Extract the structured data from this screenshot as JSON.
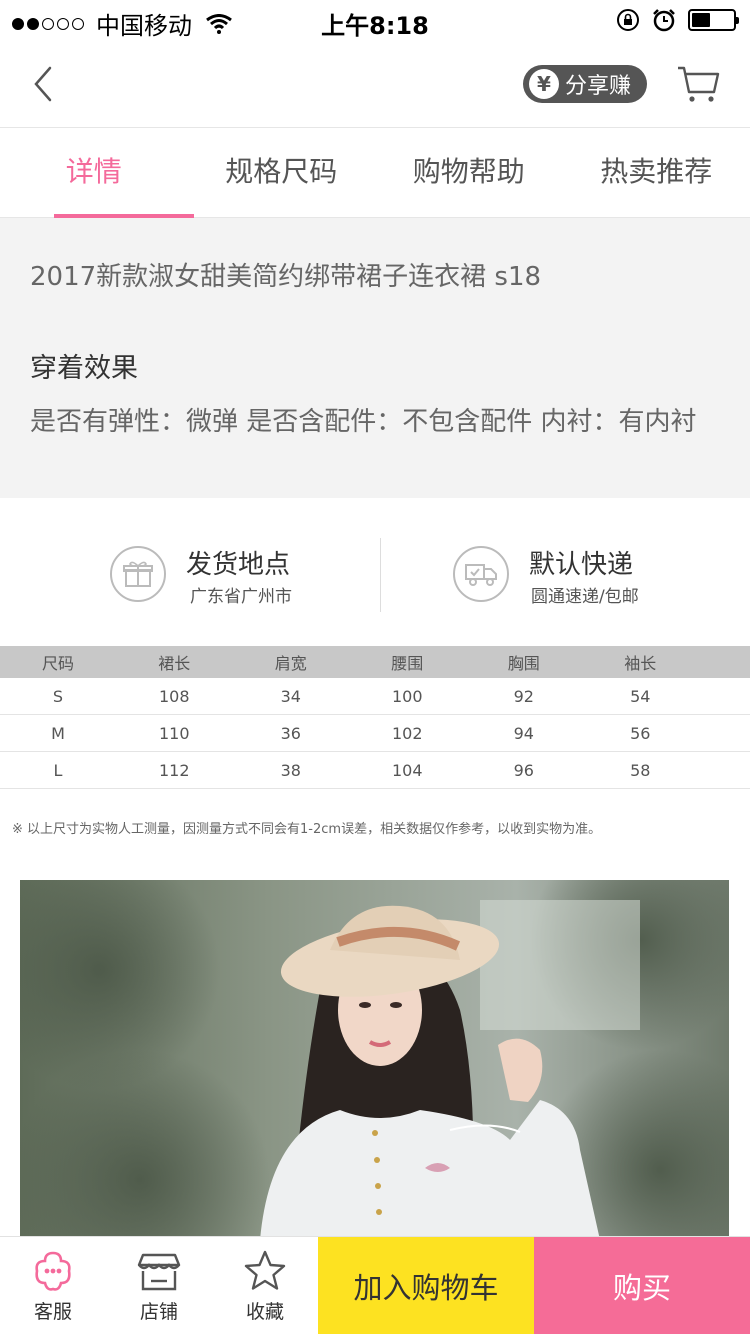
{
  "status_bar": {
    "carrier": "中国移动",
    "time": "上午8:18",
    "battery_level": 0.45
  },
  "nav": {
    "share_symbol": "¥",
    "share_label": "分享赚",
    "icons": [
      "back-arrow-icon",
      "cart-icon"
    ]
  },
  "tabs": [
    {
      "label": "详情",
      "active": true
    },
    {
      "label": "规格尺码",
      "active": false
    },
    {
      "label": "购物帮助",
      "active": false
    },
    {
      "label": "热卖推荐",
      "active": false
    }
  ],
  "detail": {
    "product_title": "2017新款淑女甜美简约绑带裙子连衣裙 s18",
    "section_title": "穿着效果",
    "attributes": "是否有弹性：微弹 是否含配件：不包含配件 内衬：有内衬"
  },
  "shipping": {
    "origin_label": "发货地点",
    "origin_value": "广东省广州市",
    "courier_label": "默认快递",
    "courier_value": "圆通速递/包邮"
  },
  "size_table": {
    "headers": [
      "尺码",
      "裙长",
      "肩宽",
      "腰围",
      "胸围",
      "袖长"
    ],
    "rows": [
      [
        "S",
        "108",
        "34",
        "100",
        "92",
        "54"
      ],
      [
        "M",
        "110",
        "36",
        "102",
        "94",
        "56"
      ],
      [
        "L",
        "112",
        "38",
        "104",
        "96",
        "58"
      ]
    ],
    "note": "※ 以上尺寸为实物人工测量，因测量方式不同会有1-2cm误差，相关数据仅作参考，以收到实物为准。"
  },
  "bottom_bar": {
    "service_label": "客服",
    "shop_label": "店铺",
    "favorite_label": "收藏",
    "add_cart_label": "加入购物车",
    "buy_label": "购买"
  },
  "colors": {
    "accent_pink": "#f46a9b",
    "buy_pink": "#f56c97",
    "cart_yellow": "#fde221"
  }
}
